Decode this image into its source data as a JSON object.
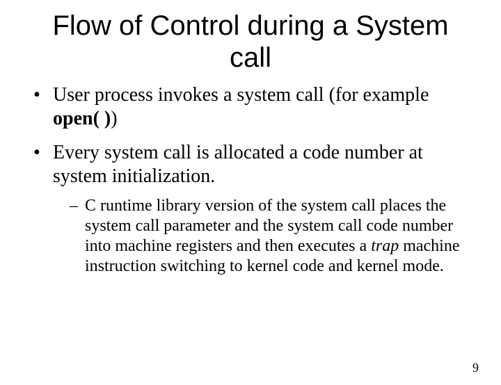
{
  "title": "Flow of Control during a System call",
  "bullets": [
    {
      "pre": "User process invokes a system call (for example ",
      "bold": "open( )",
      "post": ")"
    },
    {
      "text": "Every system call is allocated a code number at system initialization."
    }
  ],
  "subbullet": {
    "pre": "C runtime library version of the system call places the system call parameter and the system call code number into machine registers and then executes a ",
    "ital": "trap",
    "post": " machine instruction switching to kernel code and kernel mode."
  },
  "page_number": "9"
}
